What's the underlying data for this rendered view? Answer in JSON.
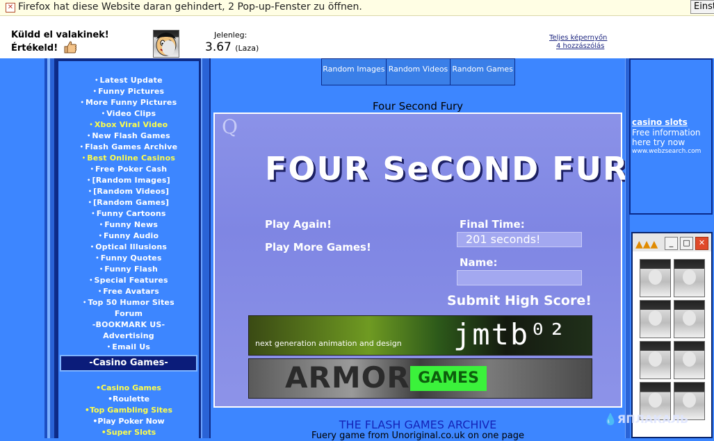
{
  "popup": {
    "message": "Firefox hat diese Website daran gehindert, 2 Pop-up-Fenster zu öffnen.",
    "button": "Einst"
  },
  "header": {
    "send": "Küldd el valakinek!",
    "rate": "Értékeld!",
    "now_label": "Jelenleg:",
    "score": "3.67",
    "score_word": "(Laza)",
    "link_fullscreen": "Teljes képernyőn",
    "link_comments": "4 hozzászólás"
  },
  "nav": {
    "items": [
      {
        "label": "Latest Update",
        "highlight": false
      },
      {
        "label": "Funny Pictures",
        "highlight": false
      },
      {
        "label": "More Funny Pictures",
        "highlight": false
      },
      {
        "label": "Video Clips",
        "highlight": false
      },
      {
        "label": "Xbox Viral Video",
        "highlight": true
      },
      {
        "label": "New Flash Games",
        "highlight": false
      },
      {
        "label": "Flash Games Archive",
        "highlight": false
      },
      {
        "label": "Best Online Casinos",
        "highlight": true
      },
      {
        "label": "Free Poker Cash",
        "highlight": false
      },
      {
        "label": "[Random Images]",
        "highlight": false
      },
      {
        "label": "[Random Videos]",
        "highlight": false
      },
      {
        "label": "[Random Games]",
        "highlight": false
      },
      {
        "label": "Funny Cartoons",
        "highlight": false
      },
      {
        "label": "Funny News",
        "highlight": false
      },
      {
        "label": "Funny Audio",
        "highlight": false
      },
      {
        "label": "Optical Illusions",
        "highlight": false
      },
      {
        "label": "Funny Quotes",
        "highlight": false
      },
      {
        "label": "Funny Flash",
        "highlight": false
      },
      {
        "label": "Special Features",
        "highlight": false
      },
      {
        "label": "Free Avatars",
        "highlight": false
      },
      {
        "label": "Top 50 Humor Sites",
        "highlight": false
      },
      {
        "label": "Forum",
        "highlight": false,
        "nodot": true
      },
      {
        "label": "-BOOKMARK US-",
        "highlight": false,
        "nodot": true
      },
      {
        "label": "Advertising",
        "highlight": false,
        "nodot": true
      },
      {
        "label": "Email Us",
        "highlight": false
      }
    ],
    "casino_heading": "-Casino Games-",
    "casino_items": [
      {
        "label": "Casino Games",
        "highlight": true
      },
      {
        "label": "Roulette",
        "highlight": false
      },
      {
        "label": "Top Gambling Sites",
        "highlight": true
      },
      {
        "label": "Play Poker Now",
        "highlight": false
      },
      {
        "label": "Super Slots",
        "highlight": true
      }
    ]
  },
  "tabs": [
    "Random Images",
    "Random Videos",
    "Random Games"
  ],
  "game": {
    "page_title": "Four Second Fury",
    "logo_letter": "Q",
    "big_title": "FOUR SeCOND FURY",
    "play_again": "Play Again!",
    "play_more": "Play More Games!",
    "final_time_label": "Final Time:",
    "final_time_value": "201 seconds!",
    "name_label": "Name:",
    "name_value": "",
    "submit": "Submit High Score!",
    "banner1_small": "next generation animation and design",
    "banner1_logo": "jmtb⁰²",
    "banner2_left": "ARMOR",
    "banner2_right": "GAMES"
  },
  "footer": {
    "archive_title": "THE FLASH GAMES ARCHIVE",
    "archive_sub": "Fuery game from Unoriginal.co.uk on one page"
  },
  "ad": {
    "title": "casino slots",
    "desc": "Free information here try now",
    "url": "www.webzsearch.com"
  },
  "watermark": "ЯПЛАКАЛЬ"
}
